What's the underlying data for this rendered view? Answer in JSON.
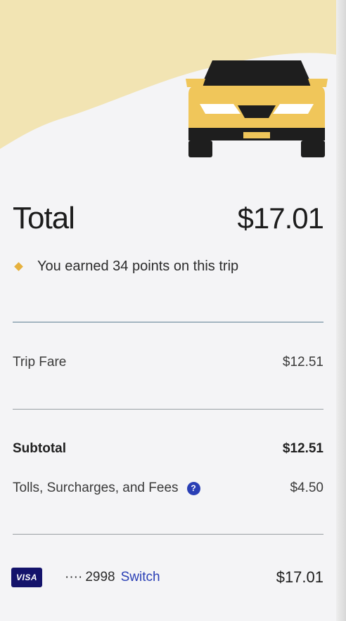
{
  "receipt": {
    "total_label": "Total",
    "total_amount": "$17.01",
    "points_text": "You earned 34 points on this trip",
    "trip_fare_label": "Trip Fare",
    "trip_fare_amount": "$12.51",
    "subtotal_label": "Subtotal",
    "subtotal_amount": "$12.51",
    "fees_label": "Tolls, Surcharges, and Fees",
    "fees_help_icon": "?",
    "fees_amount": "$4.50"
  },
  "payment": {
    "card_brand": "VISA",
    "card_mask": "····",
    "card_last4": "2998",
    "switch_label": "Switch",
    "charged_amount": "$17.01"
  },
  "colors": {
    "header_yellow": "#f2e4b3",
    "car_yellow": "#f0c65a",
    "car_dark": "#1e1e1e",
    "link_blue": "#2a3fb5",
    "visa_navy": "#14136b",
    "points_gold": "#e6b13e"
  },
  "icons": {
    "header_illustration": "taxi-car-icon",
    "points": "diamond-icon",
    "help": "question-circle-icon",
    "card": "visa-card-icon"
  }
}
